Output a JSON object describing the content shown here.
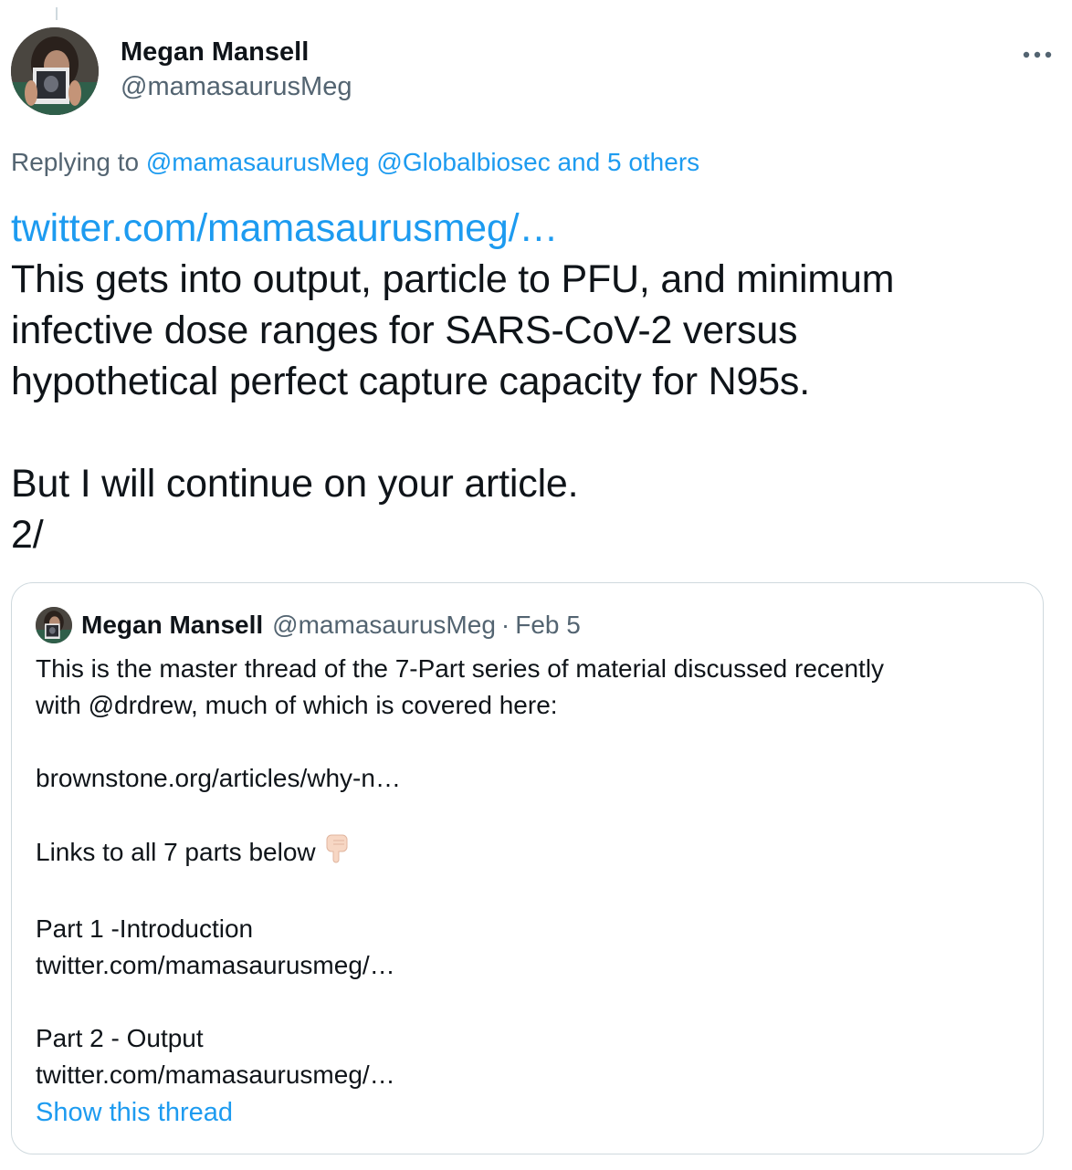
{
  "author": {
    "display_name": "Megan Mansell",
    "handle": "@mamasaurusMeg",
    "avatar_icon": "profile-photo"
  },
  "more_icon": "more-horizontal-icon",
  "replying": {
    "prefix": "Replying to",
    "mentions": [
      "@mamasaurusMeg",
      "@Globalbiosec",
      "and 5 others"
    ]
  },
  "tweet": {
    "link": "twitter.com/mamasaurusmeg/…",
    "lines": [
      "This gets into output, particle to PFU, and minimum",
      "infective dose ranges for SARS-CoV-2 versus",
      "hypothetical perfect capture capacity for N95s."
    ],
    "line_after_gap": "But I will continue on your article.",
    "counter": "2/"
  },
  "quoted_tweet": {
    "display_name": "Megan Mansell",
    "handle": "@mamasaurusMeg",
    "separator": "·",
    "date": "Feb 5",
    "intro_lines": [
      "This is the master thread of the 7-Part series of material discussed recently",
      "with @drdrew, much of which is covered here:"
    ],
    "article_link": "brownstone.org/articles/why-n…",
    "links_text": "Links to all 7 parts below",
    "links_emoji": "backhand-index-pointing-down-icon",
    "parts": [
      {
        "title": "Part 1 -Introduction",
        "link": "twitter.com/mamasaurusmeg/…"
      },
      {
        "title": "Part 2 - Output",
        "link": "twitter.com/mamasaurusmeg/…"
      }
    ],
    "show_thread": "Show this thread"
  },
  "colors": {
    "accent": "#1d9bf0",
    "text": "#0f1419",
    "secondary": "#536471",
    "border": "#cfd9de"
  }
}
